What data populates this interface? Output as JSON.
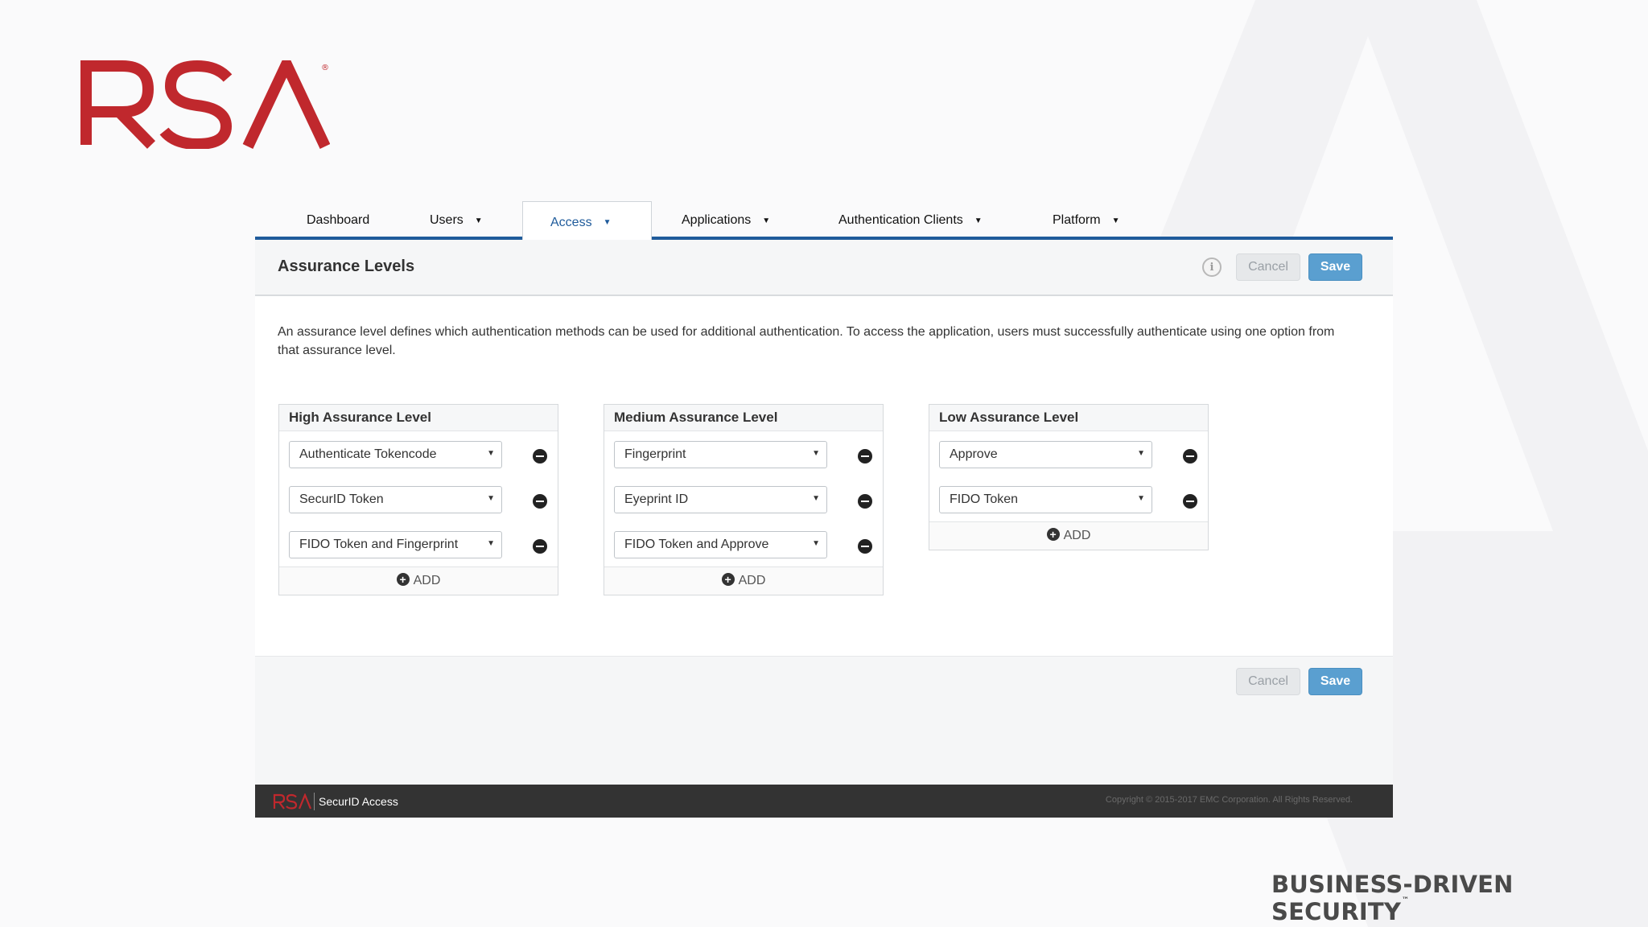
{
  "brand": {
    "logo_text": "RSA",
    "tagline": "BUSINESS-DRIVEN SECURITY",
    "trademark": "™",
    "color": "#c0282d"
  },
  "nav": {
    "tabs": [
      {
        "label": "Dashboard",
        "has_menu": false,
        "active": false
      },
      {
        "label": "Users",
        "has_menu": true,
        "active": false
      },
      {
        "label": "Access",
        "has_menu": true,
        "active": true
      },
      {
        "label": "Applications",
        "has_menu": true,
        "active": false
      },
      {
        "label": "Authentication Clients",
        "has_menu": true,
        "active": false
      },
      {
        "label": "Platform",
        "has_menu": true,
        "active": false
      }
    ],
    "caret": "▼"
  },
  "page": {
    "title": "Assurance Levels",
    "info_icon": "i",
    "cancel_label": "Cancel",
    "save_label": "Save",
    "description": "An assurance level defines which authentication methods can be used for additional authentication. To access the application, users must successfully authenticate using one option from that assurance level."
  },
  "levels": [
    {
      "title": "High Assurance Level",
      "options": [
        "Authenticate Tokencode",
        "SecurID Token",
        "FIDO Token and Fingerprint"
      ],
      "add_label": "ADD"
    },
    {
      "title": "Medium Assurance Level",
      "options": [
        "Fingerprint",
        "Eyeprint ID",
        "FIDO Token and Approve"
      ],
      "add_label": "ADD"
    },
    {
      "title": "Low Assurance Level",
      "options": [
        "Approve",
        "FIDO Token"
      ],
      "add_label": "ADD"
    }
  ],
  "bottom_actions": {
    "cancel_label": "Cancel",
    "save_label": "Save"
  },
  "footer": {
    "product": "SecurID Access",
    "copyright": "Copyright © 2015-2017 EMC Corporation. All Rights Reserved."
  },
  "colors": {
    "accent": "#1f5b9b",
    "save_button": "#5a9fd0",
    "footer_bg": "#333333"
  }
}
